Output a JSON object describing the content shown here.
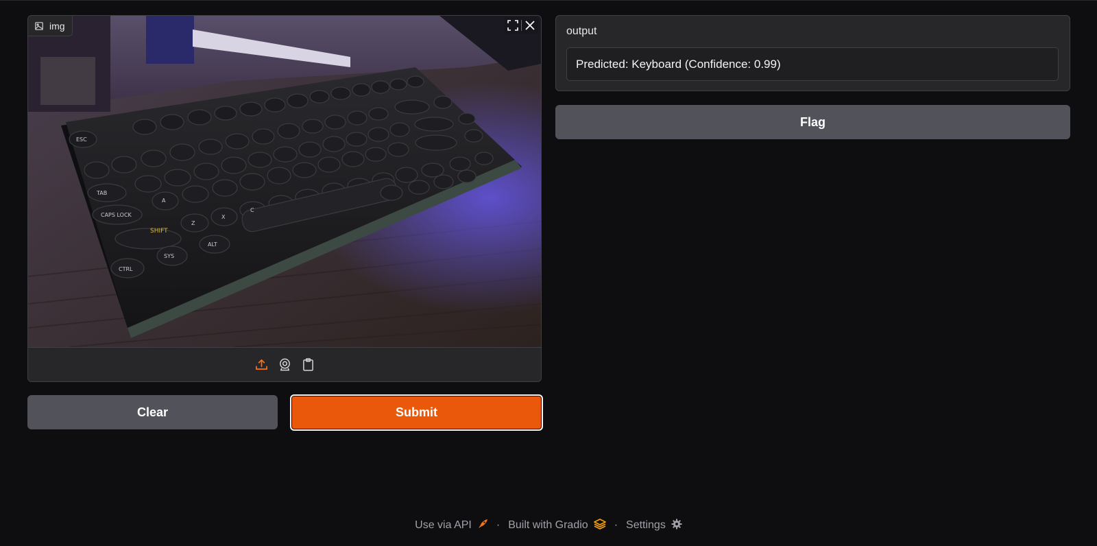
{
  "input": {
    "label": "img",
    "image_subject": "keyboard photo",
    "controls": {
      "fullscreen_icon": "fullscreen-icon",
      "close_icon": "close-icon"
    },
    "sources": [
      "upload-icon",
      "webcam-icon",
      "clipboard-icon"
    ]
  },
  "buttons": {
    "clear": "Clear",
    "submit": "Submit",
    "flag": "Flag"
  },
  "output": {
    "label": "output",
    "value": "Predicted: Keyboard (Confidence: 0.99)"
  },
  "footer": {
    "api": "Use via API",
    "built": "Built with Gradio",
    "settings": "Settings",
    "separator": "·"
  },
  "colors": {
    "accent": "#ea580c",
    "background": "#0e0e11",
    "panel": "#27272a",
    "secondary_button": "#52525b"
  }
}
